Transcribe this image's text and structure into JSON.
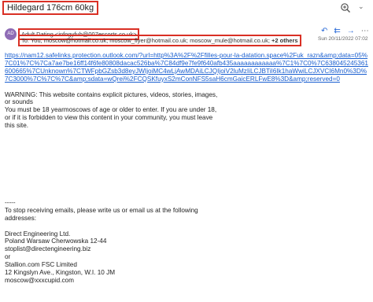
{
  "subject": "Hildegard 176cm 60kg",
  "sender": "Adult Dating <infogyfuh@007escorts.co.uk>",
  "avatar": "AD",
  "to_prefix": "To:",
  "to_list": "You; moscow@hotmail.co.uk; moscow_flyer@hotmail.co.uk; moscow_mule@hotmail.co.uk;",
  "to_more": "+2 others",
  "date": "Sun 20/11/2022 07:02",
  "link": "https://nam12.safelinks.protection.outlook.com/?url=http%3A%2F%2Ffilles-pour-la-datation.space%2Fuk_razn&amp;data=05%7C01%7C%7Ca7ae7be16ff14f6fe80808dacac526ba%7C84df9e7fe9f640afb435aaaaaaaaaaaa%7C1%7C0%7C638045245361600665%7CUnknown%7CTWFpbGZsb3d8eyJWIjoiMC4wLjAwMDAiLCJQIjoiV2luMzIiLCJBTiI6Ik1haWwiLCJXVCI6Mn0%3D%7C3000%7C%7C%7C&amp;sdata=wQrei%2FCQSKfuyxS2mConNFS5saH6cmGaicERLFwE8%3D&amp;reserved=0",
  "warning": "WARNING: This website contains explicit pictures, videos, stories, images,\nor sounds\nYou must be 18 yearmoscows of age or older to enter. If you are under 18,\nor if it is forbidden to view this content in your community, you must leave\nthis site.",
  "separator": "-----",
  "unsubscribe": "To stop receiving emails, please write us or email us at the following\naddresses:",
  "address1": "Direct Engineering Ltd.\nPoland Warsaw Cherwowska 12-44\nstoplist@directengineering.biz",
  "or": "or",
  "address2": "Stallion.com FSC Limited\n12 Kingslyn Ave., Kingston, W.I. 10 JM\nmoscow@xxxcupid.com",
  "icons": {
    "zoom": "zoom-in-icon",
    "reply": "reply-icon",
    "reply_all": "reply-all-icon",
    "forward": "forward-icon",
    "more": "more-icon"
  },
  "colors": {
    "highlight": "#d93025",
    "link": "#1a5fd0",
    "avatar": "#8e6bb5"
  }
}
